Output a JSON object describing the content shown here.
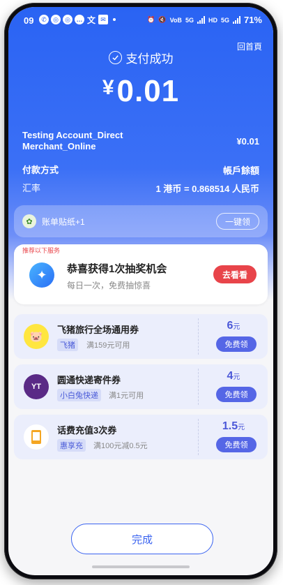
{
  "status_bar": {
    "time": "09",
    "battery": "71%",
    "net_labels": [
      "VoB",
      "5G",
      "HD",
      "5G"
    ]
  },
  "header": {
    "back_home": "回首頁",
    "success_text": "支付成功"
  },
  "payment": {
    "currency_symbol": "¥",
    "amount": "0.01",
    "merchant": "Testing Account_Direct Merchant_Online",
    "merchant_line1": "Testing Account_Direct",
    "merchant_line2": "Merchant_Online",
    "paid_amount": "¥0.01",
    "method_label": "付款方式",
    "method_value": "帳戶餘額",
    "rate_label": "汇率",
    "rate_value": "1 港币 = 0.868514 人民币"
  },
  "sticker": {
    "text": "账单贴纸+1",
    "button": "一键领"
  },
  "lottery": {
    "tag": "推荐以下服务",
    "title": "恭喜获得1次抽奖机会",
    "subtitle": "每日一次，免费抽惊喜",
    "button": "去看看"
  },
  "coupons": [
    {
      "name": "飞猪旅行全场通用券",
      "brand": "飞猪",
      "condition": "满159元可用",
      "value": "6",
      "unit": "元",
      "button": "免费领",
      "icon": "fliggy-icon"
    },
    {
      "name": "圆通快递寄件券",
      "brand": "小白兔快递",
      "condition": "满1元可用",
      "value": "4",
      "unit": "元",
      "button": "免费领",
      "icon": "yto-icon"
    },
    {
      "name": "话费充值3次券",
      "brand": "惠享充",
      "condition": "满100元减0.5元",
      "value": "1.5",
      "unit": "元",
      "button": "免费领",
      "icon": "phone-icon"
    }
  ],
  "footer": {
    "done": "完成"
  },
  "colors": {
    "primary": "#2a63f3",
    "danger": "#e8444a",
    "coupon_accent": "#4a57d8"
  }
}
